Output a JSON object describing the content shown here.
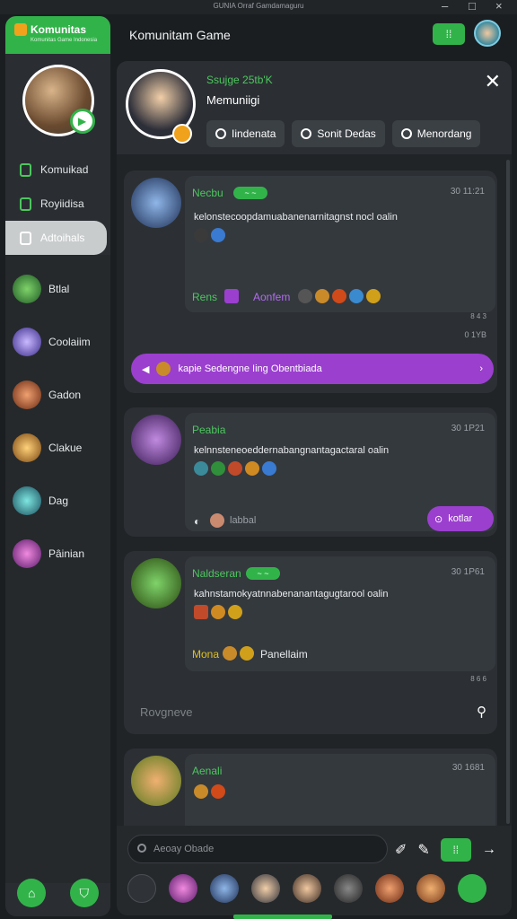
{
  "window": {
    "title": "GUNIA Orraf Gamdamaguru"
  },
  "sidebar": {
    "brand": "Komunitas",
    "brand_sub": "Komunitas Game Indonesia",
    "nav": [
      {
        "label": "Komuikad",
        "active": false
      },
      {
        "label": "Royiidisa",
        "active": false
      },
      {
        "label": "Adtoihals",
        "active": true
      }
    ],
    "channels": [
      {
        "label": "Btlal",
        "color": "#2f8f3a"
      },
      {
        "label": "Coolaiim",
        "color": "#6a5ad0"
      },
      {
        "label": "Gadon",
        "color": "#c2572a"
      },
      {
        "label": "Clakue",
        "color": "#d08a22"
      },
      {
        "label": "Dag",
        "color": "#2aa0a0"
      },
      {
        "label": "Pâinian",
        "color": "#a03ab8"
      }
    ]
  },
  "header": {
    "title": "Komunitam Game"
  },
  "hero": {
    "line1": "Ssujge 25tb'K",
    "line2": "Memuniigi",
    "tabs": [
      "Iindenata",
      "Sonit Dedas",
      "Menordang"
    ]
  },
  "posts": [
    {
      "name": "Necbu",
      "time": "30 11:21",
      "text": "kelonstecoopdamuabanenarnitagnst nocl oalin",
      "footer_left": "Rens",
      "footer_right": "Aonfem",
      "meta": [
        "8 4 3",
        "0 1YB"
      ],
      "banner": "kapie Sedengne Iing Obentbiada"
    },
    {
      "name": "Peabia",
      "time": "30 1P21",
      "text": "kelnnsteneoeddernabangnantagactaral oalin",
      "footer": "labbal",
      "button": "kotlar"
    },
    {
      "name": "Naldseran",
      "time": "30 1P61",
      "text": "kahnstamokyatnnabenanantagugtarool oalin",
      "footer_left": "Mona",
      "footer_right": "Panellaim",
      "meta": "8 6 6",
      "reply_placeholder": "Rovgneve"
    },
    {
      "name": "Aenali",
      "time": "30 1681"
    }
  ],
  "composer": {
    "placeholder": "Aeoay Obade"
  },
  "colors": {
    "accent": "#32b34a",
    "purple": "#9b3fcf",
    "bg": "#1b1e21"
  }
}
